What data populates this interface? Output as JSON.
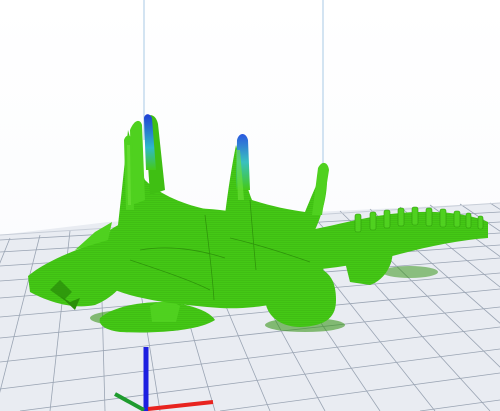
{
  "app": {
    "view": "3d-preview",
    "background_color": "#ffffff",
    "build_plate": {
      "fill_color": "#e9ecf2",
      "grid_color": "#9aa4b3",
      "edge_color": "#c8ced8"
    },
    "print_volume_edge_color": "#a8c9e6",
    "model": {
      "icon_name": "dragon-model",
      "color": "#44c915",
      "shade_color": "#2b8f0a",
      "highlight_color": "#6fe33b",
      "overhang_tip_colors": [
        "#1f3fd6",
        "#2fb9c9"
      ]
    },
    "axes": {
      "x_color": "#e8231f",
      "y_color": "#1e9b2e",
      "z_color": "#1d1fe0"
    }
  }
}
